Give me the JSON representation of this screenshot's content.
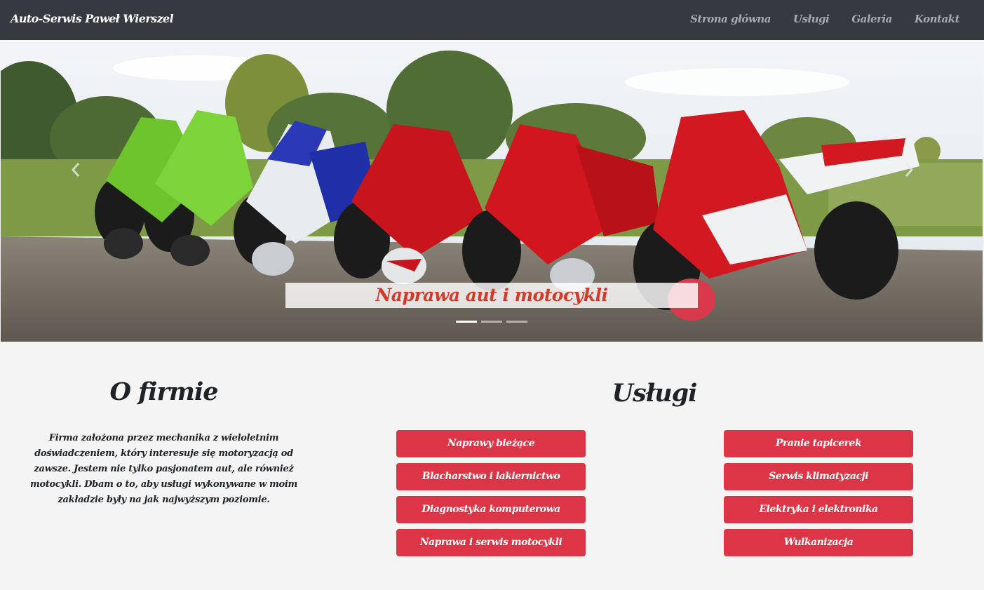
{
  "navbar": {
    "brand": "Auto-Serwis Paweł Wierszel",
    "links": [
      "Strona główna",
      "Usługi",
      "Galeria",
      "Kontakt"
    ]
  },
  "carousel": {
    "caption": "Naprawa aut i motocykli",
    "slide_count": 3,
    "active_index": 0,
    "prev_icon": "chevron-left-icon",
    "next_icon": "chevron-right-icon"
  },
  "about": {
    "title": "O firmie",
    "text": "Firma założona przez mechanika z wieloletnim doświadczeniem, który interesuje się motoryzacją od zawsze. Jestem nie tylko pasjonatem aut, ale również motocykli. Dbam o to, aby usługi wykonywane w moim zakładzie były na jak najwyższym poziomie."
  },
  "services": {
    "title": "Usługi",
    "left": [
      "Naprawy bieżące",
      "Blacharstwo i lakiernictwo",
      "Diagnostyka komputerowa",
      "Naprawa i serwis motocykli"
    ],
    "right": [
      "Pranie tapicerek",
      "Serwis klimatyzacji",
      "Elektryka i elektronika",
      "Wulkanizacja"
    ]
  },
  "colors": {
    "navbar_bg": "#343a40",
    "button_bg": "#dc3545",
    "caption_text": "#d33a2c",
    "page_bg": "#f4f4f4"
  }
}
